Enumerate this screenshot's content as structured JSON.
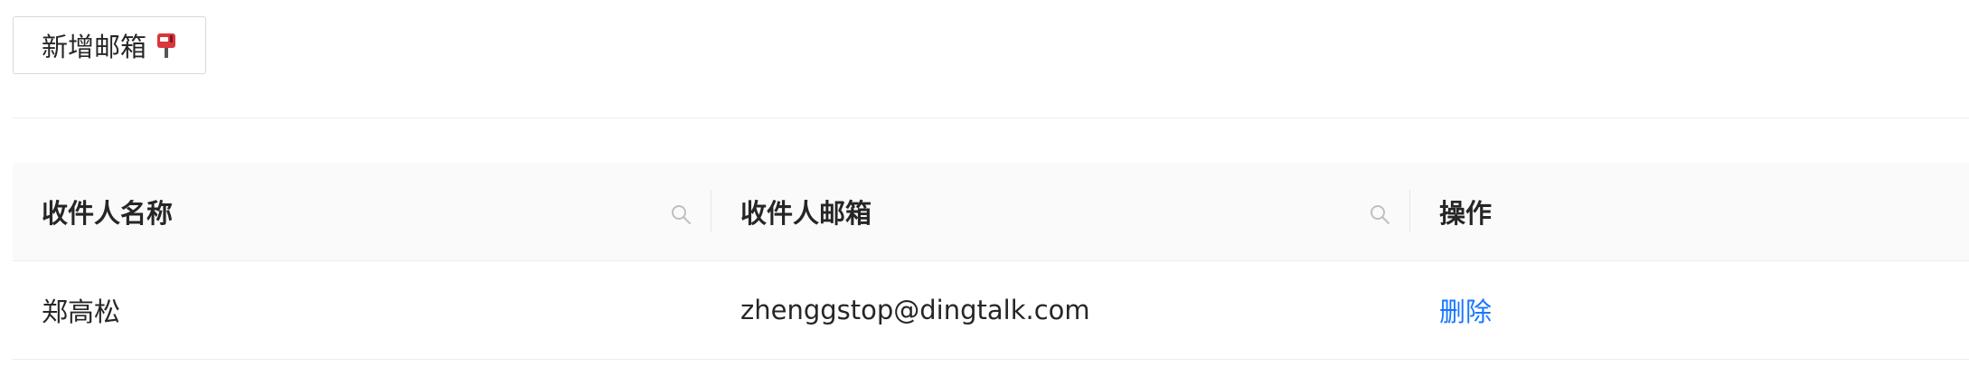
{
  "toolbar": {
    "add_button_label": "新增邮箱",
    "add_button_icon": "mailbox-icon"
  },
  "table": {
    "columns": [
      {
        "label": "收件人名称",
        "searchable": true
      },
      {
        "label": "收件人邮箱",
        "searchable": true
      },
      {
        "label": "操作",
        "searchable": false
      }
    ],
    "rows": [
      {
        "name": "郑高松",
        "email": "zhenggstop@dingtalk.com",
        "action": "删除"
      }
    ]
  },
  "colors": {
    "link": "#1677ff",
    "header_bg": "#fafafa",
    "border": "#ececec",
    "mailbox_red": "#d9363e"
  }
}
